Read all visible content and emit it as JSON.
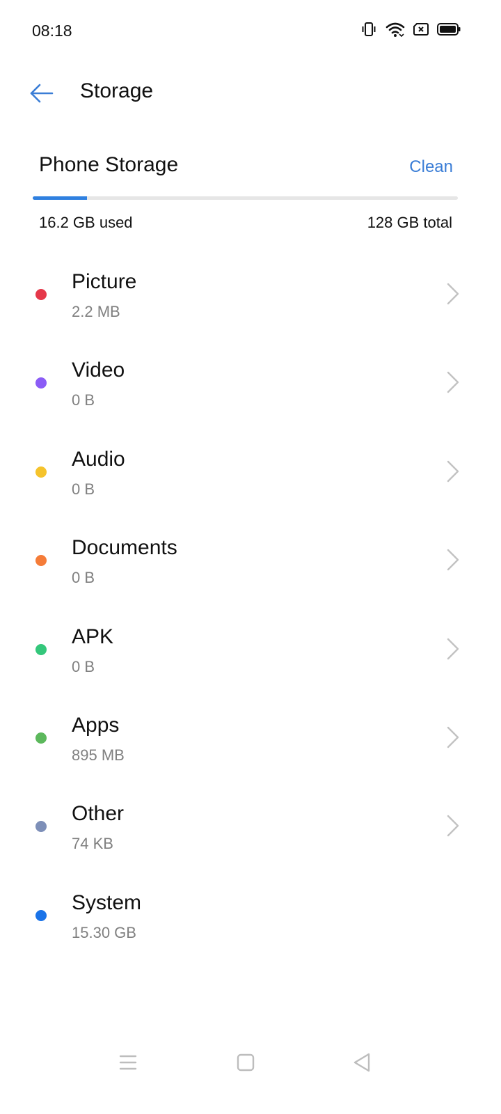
{
  "status_bar": {
    "time": "08:18",
    "icons": [
      "vibrate-icon",
      "wifi-icon",
      "sim-card-error-icon",
      "battery-icon"
    ]
  },
  "app_bar": {
    "title": "Storage",
    "back_icon": "arrow-left-icon",
    "accent_color": "#3a7dd6"
  },
  "storage": {
    "section_title": "Phone Storage",
    "clean_label": "Clean",
    "used_text": "16.2  GB used",
    "total_text": "128 GB total",
    "used_fraction": 0.127,
    "bar_color": "#2f80e0"
  },
  "categories": [
    {
      "name": "Picture",
      "size": "2.2 MB",
      "color": "#e5384a",
      "has_chevron": true
    },
    {
      "name": "Video",
      "size": "0 B",
      "color": "#8b5cf6",
      "has_chevron": true
    },
    {
      "name": "Audio",
      "size": "0 B",
      "color": "#f5c32c",
      "has_chevron": true
    },
    {
      "name": "Documents",
      "size": "0 B",
      "color": "#f57c38",
      "has_chevron": true
    },
    {
      "name": "APK",
      "size": "0 B",
      "color": "#34c77b",
      "has_chevron": true
    },
    {
      "name": "Apps",
      "size": "895 MB",
      "color": "#5cb85c",
      "has_chevron": true
    },
    {
      "name": "Other",
      "size": "74 KB",
      "color": "#7d8fb8",
      "has_chevron": true
    },
    {
      "name": "System",
      "size": "15.30  GB",
      "color": "#1a73e8",
      "has_chevron": false
    }
  ],
  "nav_bar": {
    "icons": [
      "menu-icon",
      "home-square-icon",
      "back-triangle-icon"
    ]
  }
}
